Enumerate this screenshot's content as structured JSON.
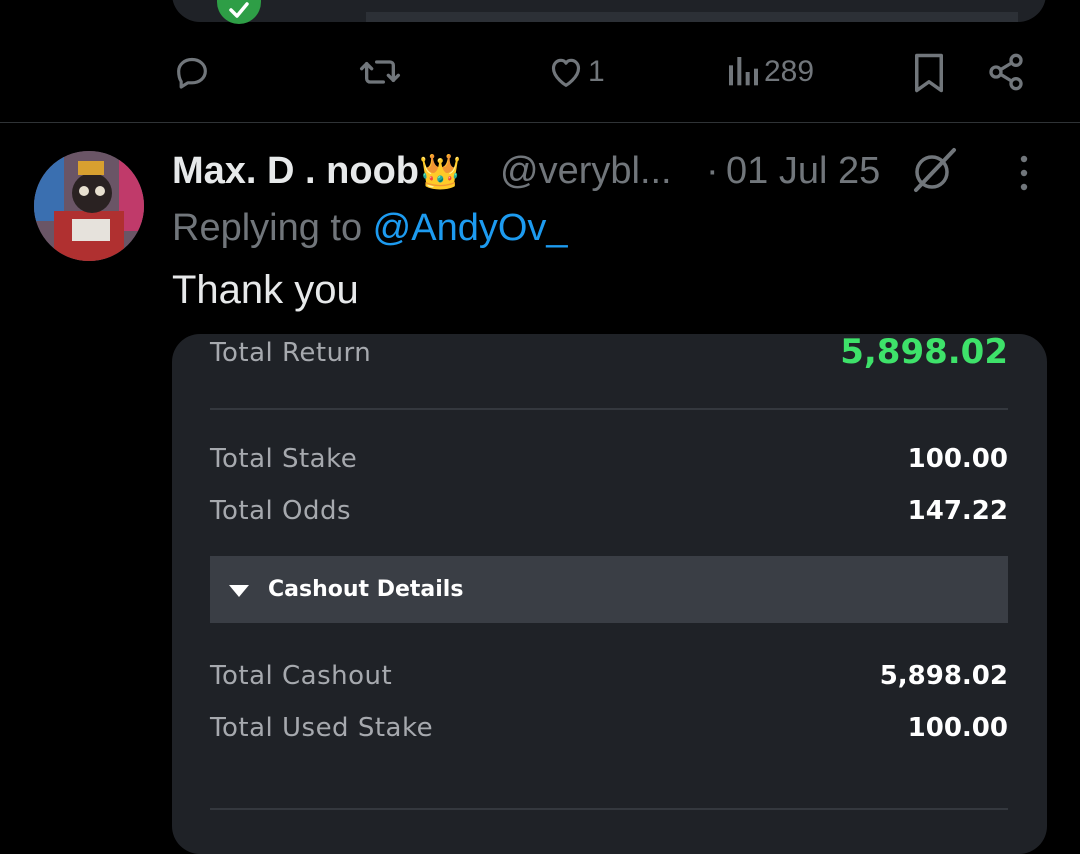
{
  "prev_tweet": {
    "actions": {
      "replies": "",
      "retweets": "",
      "likes": "1",
      "views": "289"
    }
  },
  "tweet": {
    "display_name": "Max. D . noob",
    "name_emoji": "👑",
    "handle": "@verybl...",
    "separator": "·",
    "date": "01 Jul 25",
    "reply_prefix": "Replying to ",
    "reply_to": "@AndyOv_",
    "text": "Thank you"
  },
  "bet_slip": {
    "total_return_label": "Total Return",
    "total_return_value": "5,898.02",
    "total_stake_label": "Total Stake",
    "total_stake_value": "100.00",
    "total_odds_label": "Total Odds",
    "total_odds_value": "147.22",
    "cashout_details_label": "Cashout Details",
    "total_cashout_label": "Total Cashout",
    "total_cashout_value": "5,898.02",
    "total_used_stake_label": "Total Used Stake",
    "total_used_stake_value": "100.00"
  },
  "colors": {
    "background": "#000000",
    "muted": "#71767b",
    "mention": "#1d9bf0",
    "return_green": "#3ee26a",
    "card": "#1f2227"
  },
  "icons": [
    "check-icon",
    "reply-icon",
    "retweet-icon",
    "heart-icon",
    "views-icon",
    "bookmark-icon",
    "share-icon",
    "grok-icon",
    "more-icon",
    "caret-down-icon"
  ]
}
